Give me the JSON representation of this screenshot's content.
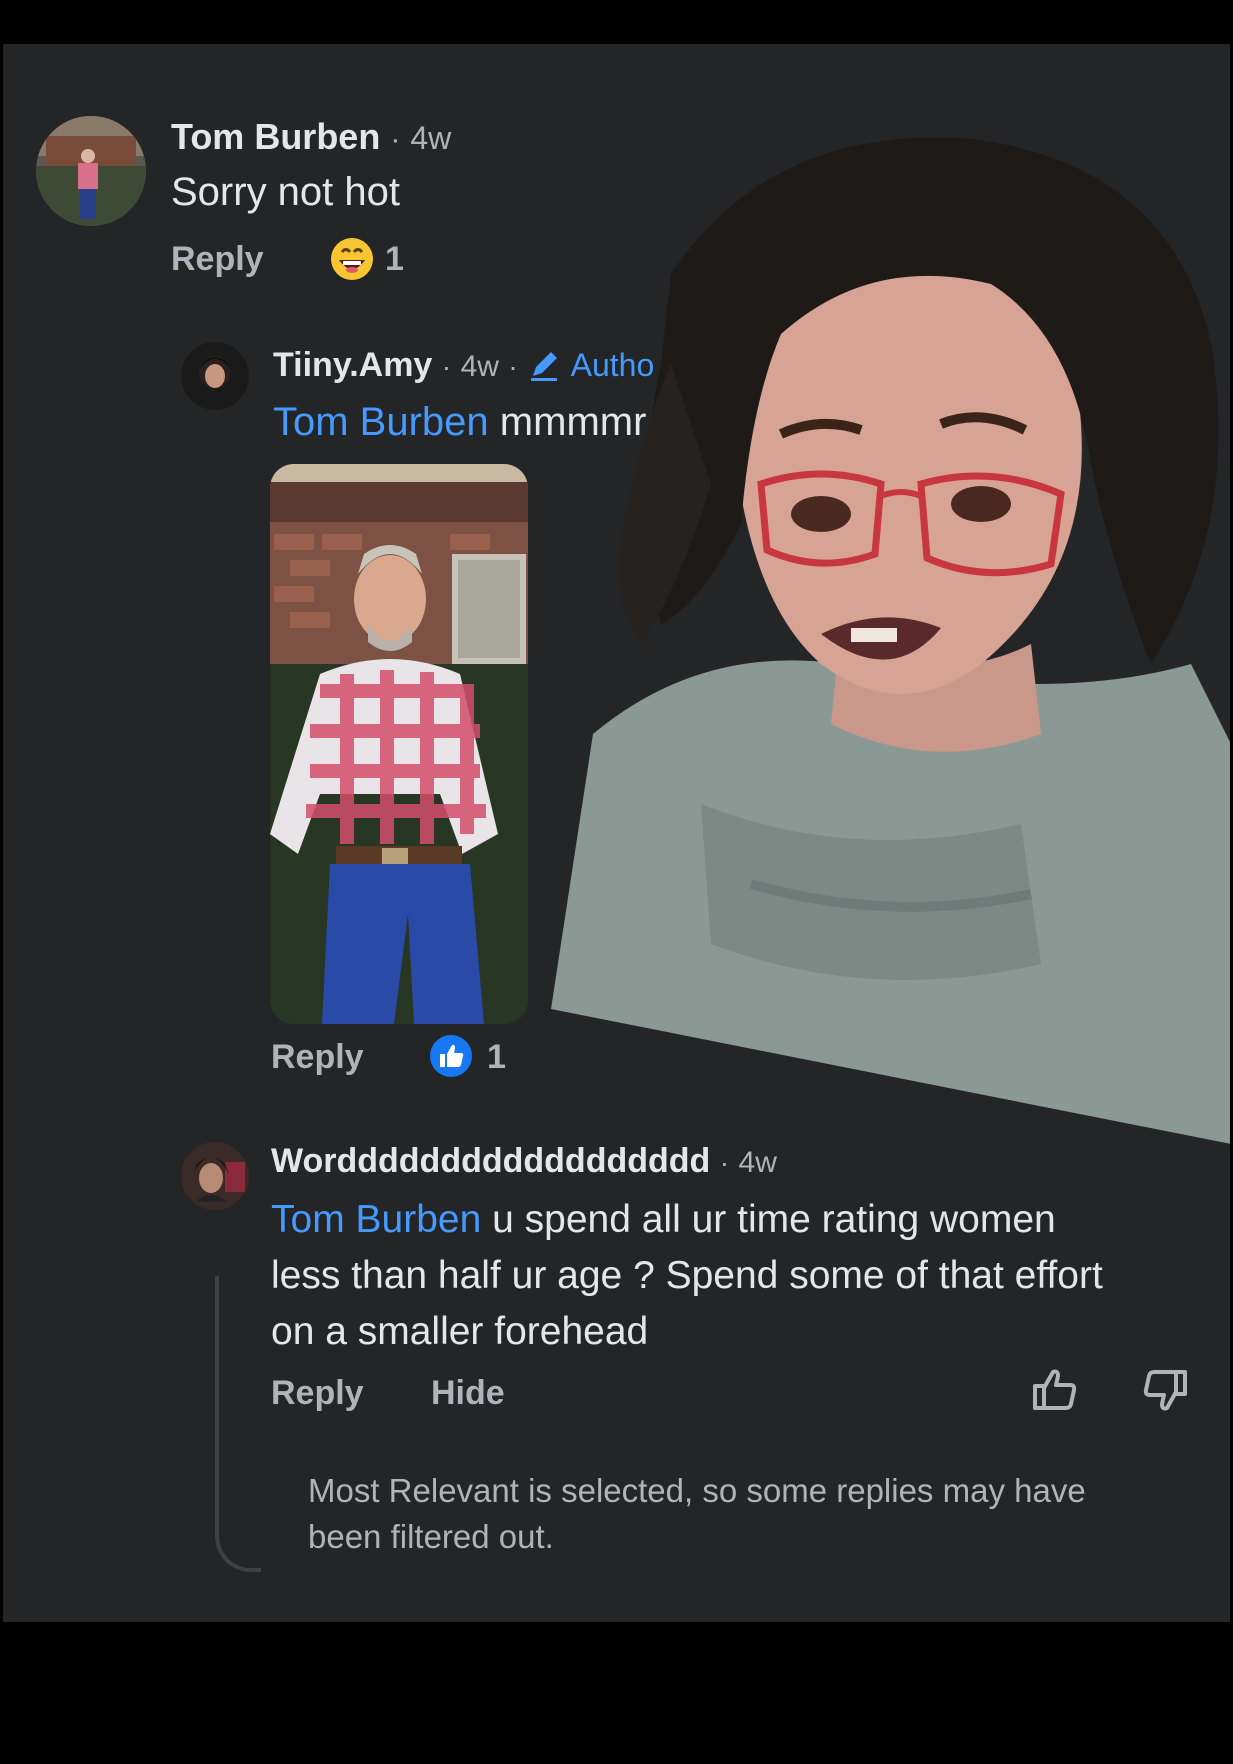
{
  "top_clip_text": "",
  "comments": [
    {
      "author": "Tom Burben",
      "separator": "·",
      "time": "4w",
      "text": "Sorry not hot",
      "reply_label": "Reply",
      "reaction": {
        "icon": "grinning-emoji-icon",
        "count": "1"
      }
    },
    {
      "author": "Tiiny.Amy",
      "separator": "·",
      "time": "4w",
      "badge_separator": "·",
      "badge": "Autho",
      "mention": "Tom Burben",
      "text": "mmmmr",
      "reply_label": "Reply",
      "reaction": {
        "icon": "like-icon",
        "count": "1"
      }
    },
    {
      "author": "Wordddddddddddddddddd",
      "separator": "·",
      "time": "4w",
      "mention": "Tom Burben",
      "text_line1": "u spend all ur time rating women",
      "text_line2": "less than half ur age ? Spend some of that effort",
      "text_line3": "on a smaller forehead",
      "reply_label": "Reply",
      "hide_label": "Hide"
    }
  ],
  "filter_notice_line1": "Most Relevant is selected, so some replies may have",
  "filter_notice_line2": "been filtered out.",
  "colors": {
    "background": "#242526",
    "mention": "#4599ff",
    "like_blue": "#1877f2"
  }
}
